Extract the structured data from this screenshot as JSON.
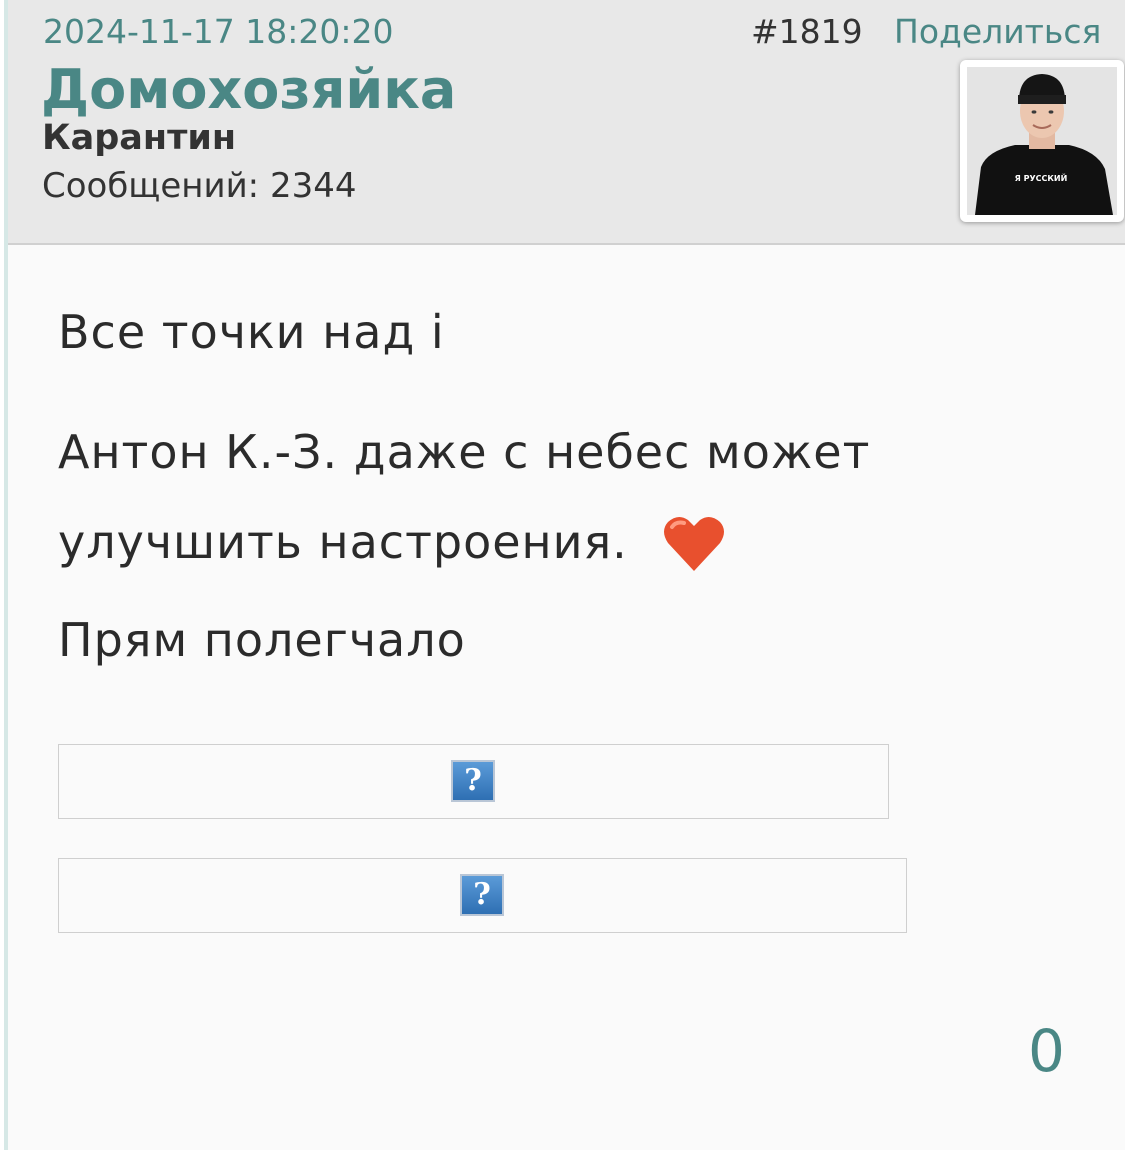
{
  "post": {
    "timestamp": "2024-11-17 18:20:20",
    "number": "#1819",
    "share_label": "Поделиться",
    "author": {
      "name": "Домохозяйка",
      "status": "Карантин",
      "posts_count": "Сообщений: 2344",
      "avatar_shirt_text": "Я РУССКИЙ"
    },
    "body": {
      "lines": [
        "Все точки над і",
        "Антон К.-З. даже с небес может",
        "улучшить настроения.",
        "Прям полегчало"
      ],
      "emoji": "heart-icon",
      "broken_images": [
        {
          "glyph": "?"
        },
        {
          "glyph": "?"
        }
      ]
    },
    "like_count": "0"
  },
  "colors": {
    "accent": "#4a8785",
    "header_bg": "#e8e8e8",
    "body_bg": "#fafafa",
    "text": "#2b2b2b",
    "heart": "#e8502e"
  }
}
